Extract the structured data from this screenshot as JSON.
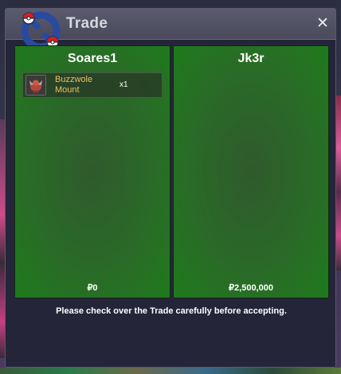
{
  "window": {
    "title": "Trade",
    "close_label": "✕"
  },
  "trade": {
    "left": {
      "player_name": "Soares1",
      "items": [
        {
          "name": "Buzzwole Mount",
          "quantity": "x1",
          "icon": "buzzwole-mount-icon"
        }
      ],
      "currency": "₽0"
    },
    "right": {
      "player_name": "Jk3r",
      "items": [],
      "currency": "₽2,500,000"
    }
  },
  "notice": "Please check over the Trade carefully before accepting.",
  "colors": {
    "panel_green": "#2a6a28",
    "item_name": "#e8c060",
    "titlebar": "#4a4a5c",
    "window_bg": "#25253a"
  }
}
